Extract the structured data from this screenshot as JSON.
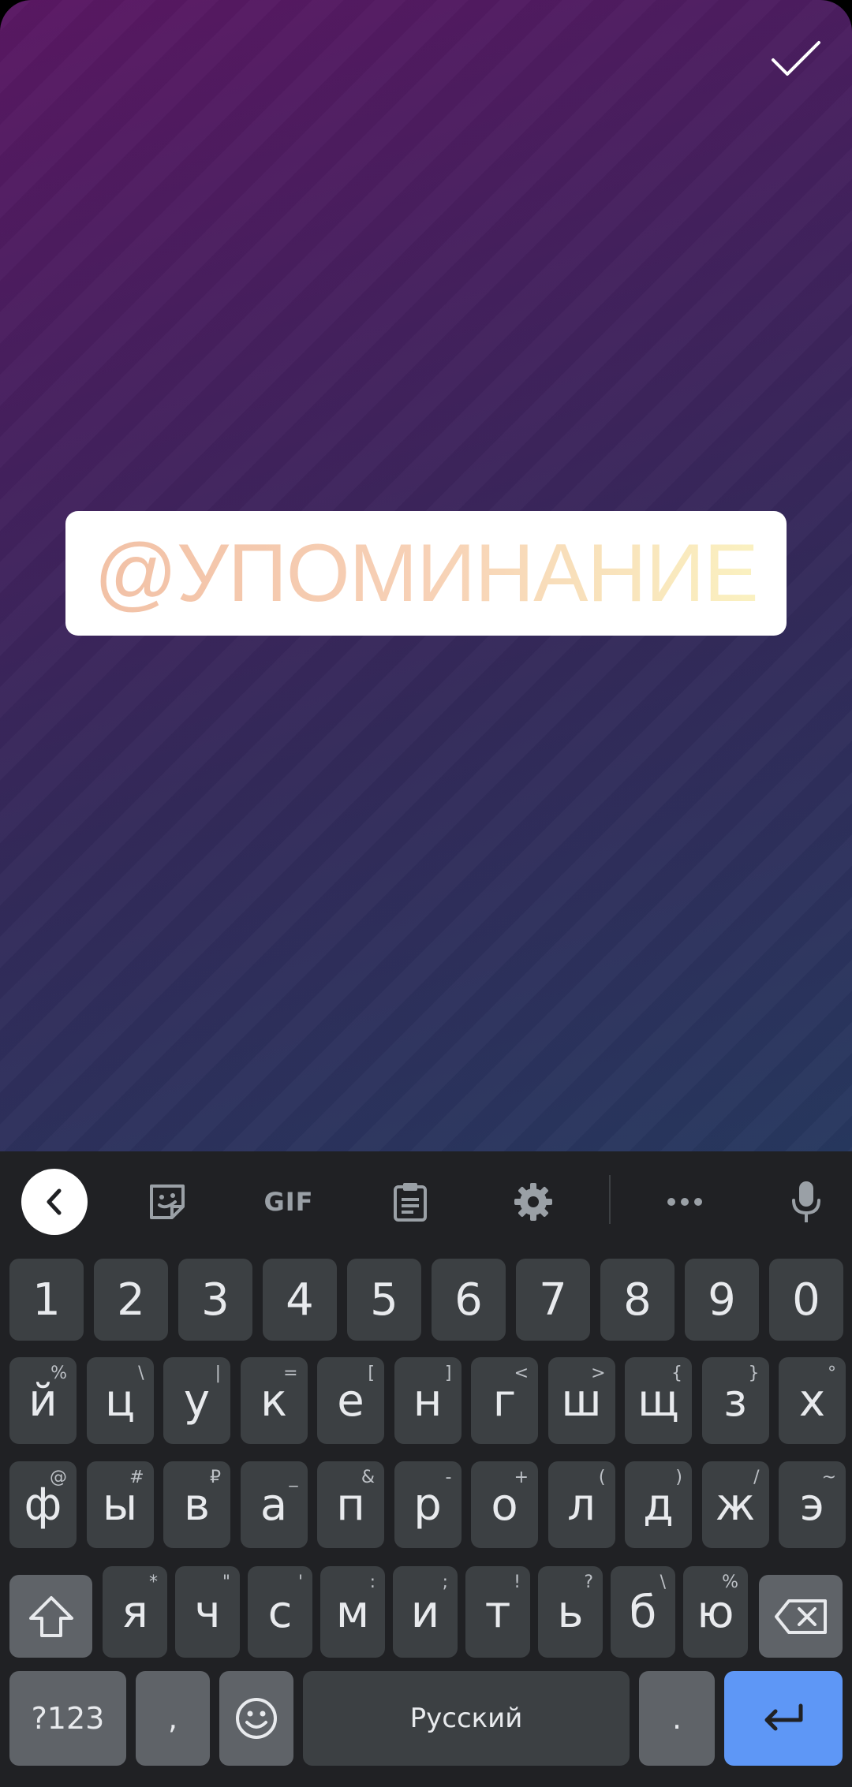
{
  "canvas": {
    "mention_text": "@УПОМИНАНИЕ",
    "gradient_colors": [
      "#5a1763",
      "#332a5a",
      "#27385f"
    ],
    "done_icon": "checkmark-icon"
  },
  "toolbar": {
    "gif_label": "GIF",
    "icons": [
      "chevron-left-icon",
      "sticker-icon",
      "gif-icon",
      "clipboard-icon",
      "gear-icon",
      "more-icon",
      "microphone-icon"
    ]
  },
  "keyboard": {
    "number_row": [
      "1",
      "2",
      "3",
      "4",
      "5",
      "6",
      "7",
      "8",
      "9",
      "0"
    ],
    "row1": [
      {
        "key": "й",
        "hint": "%"
      },
      {
        "key": "ц",
        "hint": "\\"
      },
      {
        "key": "у",
        "hint": "|"
      },
      {
        "key": "к",
        "hint": "="
      },
      {
        "key": "е",
        "hint": "["
      },
      {
        "key": "н",
        "hint": "]"
      },
      {
        "key": "г",
        "hint": "<"
      },
      {
        "key": "ш",
        "hint": ">"
      },
      {
        "key": "щ",
        "hint": "{"
      },
      {
        "key": "з",
        "hint": "}"
      },
      {
        "key": "х",
        "hint": "°"
      }
    ],
    "row2": [
      {
        "key": "ф",
        "hint": "@"
      },
      {
        "key": "ы",
        "hint": "#"
      },
      {
        "key": "в",
        "hint": "₽"
      },
      {
        "key": "а",
        "hint": "_"
      },
      {
        "key": "п",
        "hint": "&"
      },
      {
        "key": "р",
        "hint": "-"
      },
      {
        "key": "о",
        "hint": "+"
      },
      {
        "key": "л",
        "hint": "("
      },
      {
        "key": "д",
        "hint": ")"
      },
      {
        "key": "ж",
        "hint": "/"
      },
      {
        "key": "э",
        "hint": "~"
      }
    ],
    "row3": [
      {
        "key": "я",
        "hint": "*"
      },
      {
        "key": "ч",
        "hint": "\""
      },
      {
        "key": "с",
        "hint": "'"
      },
      {
        "key": "м",
        "hint": ":"
      },
      {
        "key": "и",
        "hint": ";"
      },
      {
        "key": "т",
        "hint": "!"
      },
      {
        "key": "ь",
        "hint": "?"
      },
      {
        "key": "б",
        "hint": "\\"
      },
      {
        "key": "ю",
        "hint": "%"
      }
    ],
    "symbols_label": "?123",
    "comma": ",",
    "space_label": "Русский",
    "period": ".",
    "accent_color": "#5e97f6"
  }
}
